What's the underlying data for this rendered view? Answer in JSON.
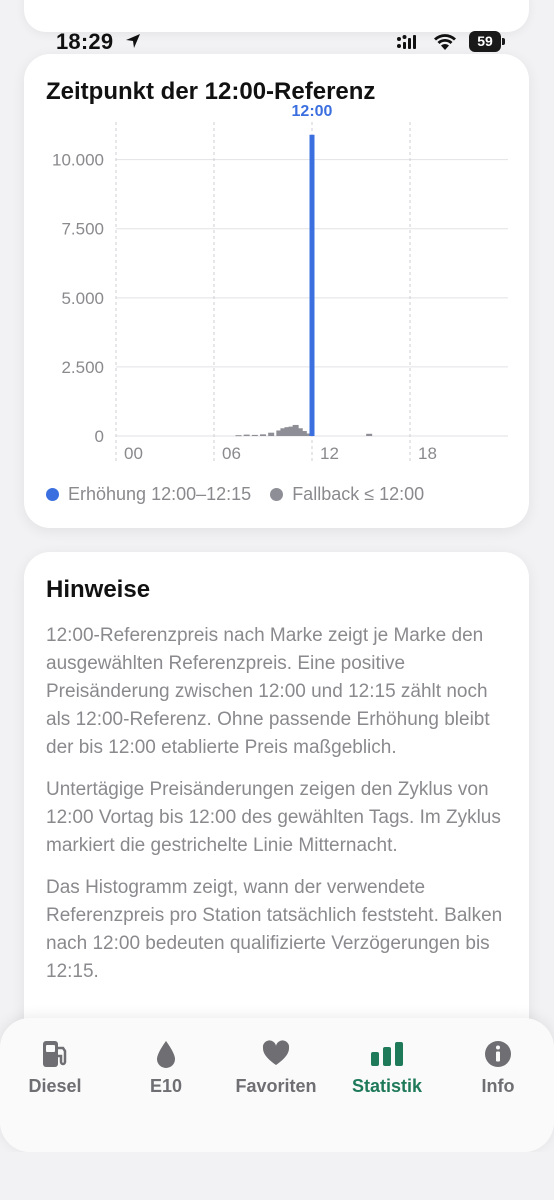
{
  "status_bar": {
    "time": "18:29",
    "battery": "59"
  },
  "chart_card": {
    "title": "Zeitpunkt der 12:00-Referenz",
    "legend": [
      {
        "label": "Erhöhung 12:00–12:15",
        "color": "#3b6fe0"
      },
      {
        "label": "Fallback ≤ 12:00",
        "color": "#8e8e96"
      }
    ]
  },
  "chart_data": {
    "type": "bar",
    "title": "Zeitpunkt der 12:00-Referenz",
    "x_ticks": [
      "00",
      "06",
      "12",
      "18"
    ],
    "y_ticks": [
      "0",
      "2.500",
      "5.000",
      "7.500",
      "10.000"
    ],
    "ylim": [
      0,
      11000
    ],
    "xlim": [
      0,
      24
    ],
    "grid": true,
    "legend_placement": "bottom-left",
    "annotation": "12:00",
    "series": [
      {
        "name": "Fallback ≤ 12:00",
        "color": "#8e8e96",
        "points": [
          {
            "x": 7.5,
            "y": 30
          },
          {
            "x": 8.0,
            "y": 50
          },
          {
            "x": 8.5,
            "y": 40
          },
          {
            "x": 9.0,
            "y": 60
          },
          {
            "x": 9.5,
            "y": 120
          },
          {
            "x": 10.0,
            "y": 200
          },
          {
            "x": 10.25,
            "y": 280
          },
          {
            "x": 10.5,
            "y": 320
          },
          {
            "x": 10.75,
            "y": 340
          },
          {
            "x": 11.0,
            "y": 400
          },
          {
            "x": 11.25,
            "y": 280
          },
          {
            "x": 11.5,
            "y": 180
          },
          {
            "x": 11.75,
            "y": 90
          },
          {
            "x": 15.5,
            "y": 80
          }
        ]
      },
      {
        "name": "Erhöhung 12:00–12:15",
        "color": "#3b6fe0",
        "points": [
          {
            "x": 12.0,
            "y": 10900
          }
        ]
      }
    ]
  },
  "notes_card": {
    "title": "Hinweise",
    "paragraphs": [
      "12:00-Referenzpreis nach Marke zeigt je Marke den ausgewählten Referenzpreis. Eine positive Preisänderung zwischen 12:00 und 12:15 zählt noch als 12:00-Referenz. Ohne passende Erhöhung bleibt der bis 12:00 etablierte Preis maßgeblich.",
      "Untertägige Preisänderungen zeigen den Zyklus von 12:00 Vortag bis 12:00 des gewählten Tags. Im Zyklus markiert die gestrichelte Linie Mitternacht.",
      "Das Histogramm zeigt, wann der verwendete Referenzpreis pro Station tatsächlich feststeht. Balken nach 12:00 bedeuten qualifizierte Verzögerungen bis 12:15."
    ]
  },
  "tabbar": {
    "active_color": "#1f7a5a",
    "tabs": [
      {
        "label": "Diesel",
        "icon": "fuel-pump-icon"
      },
      {
        "label": "E10",
        "icon": "drop-icon"
      },
      {
        "label": "Favoriten",
        "icon": "heart-icon"
      },
      {
        "label": "Statistik",
        "icon": "bar-chart-icon",
        "active": true
      },
      {
        "label": "Info",
        "icon": "info-icon"
      }
    ]
  }
}
